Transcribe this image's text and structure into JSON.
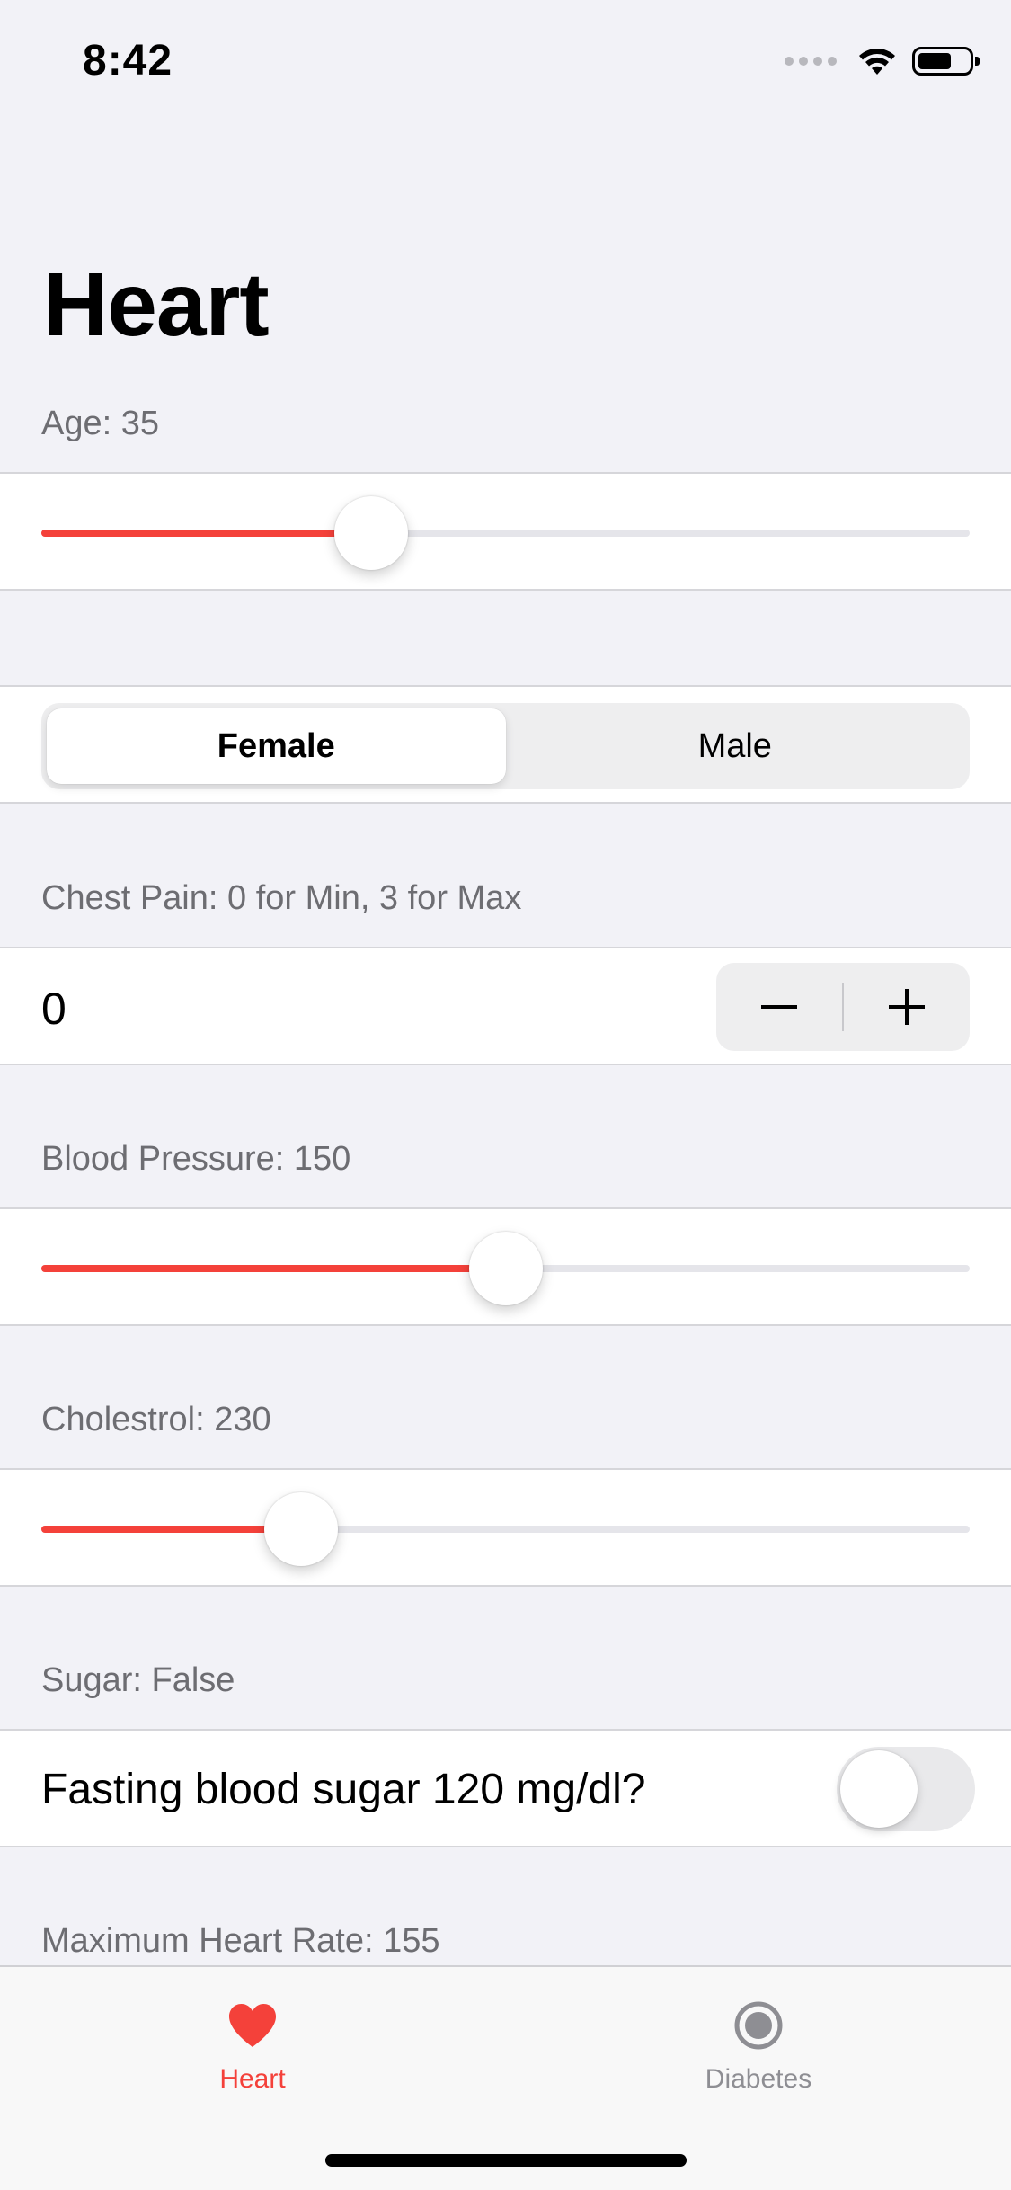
{
  "status_bar": {
    "time": "8:42"
  },
  "page": {
    "title": "Heart"
  },
  "age": {
    "label": "Age: 35",
    "slider_fraction": 0.355
  },
  "sex": {
    "options": [
      "Female",
      "Male"
    ],
    "selected": "Female"
  },
  "chest_pain": {
    "label": "Chest Pain: 0 for Min, 3 for Max",
    "value": "0",
    "minus": "−",
    "plus": "+"
  },
  "blood_pressure": {
    "label": "Blood Pressure: 150",
    "slider_fraction": 0.5
  },
  "cholesterol": {
    "label": "Cholestrol: 230",
    "slider_fraction": 0.28
  },
  "sugar": {
    "label": "Sugar: False",
    "toggle_label": "Fasting blood sugar 120 mg/dl?",
    "toggle_on": false
  },
  "max_heart_rate": {
    "label": "Maximum Heart Rate: 155"
  },
  "tab_bar": {
    "tabs": [
      {
        "label": "Heart",
        "icon": "heart-icon",
        "active": true
      },
      {
        "label": "Diabetes",
        "icon": "record-circle-icon",
        "active": false
      }
    ],
    "accent_color": "#f4413a",
    "inactive_color": "#8e8e93"
  }
}
